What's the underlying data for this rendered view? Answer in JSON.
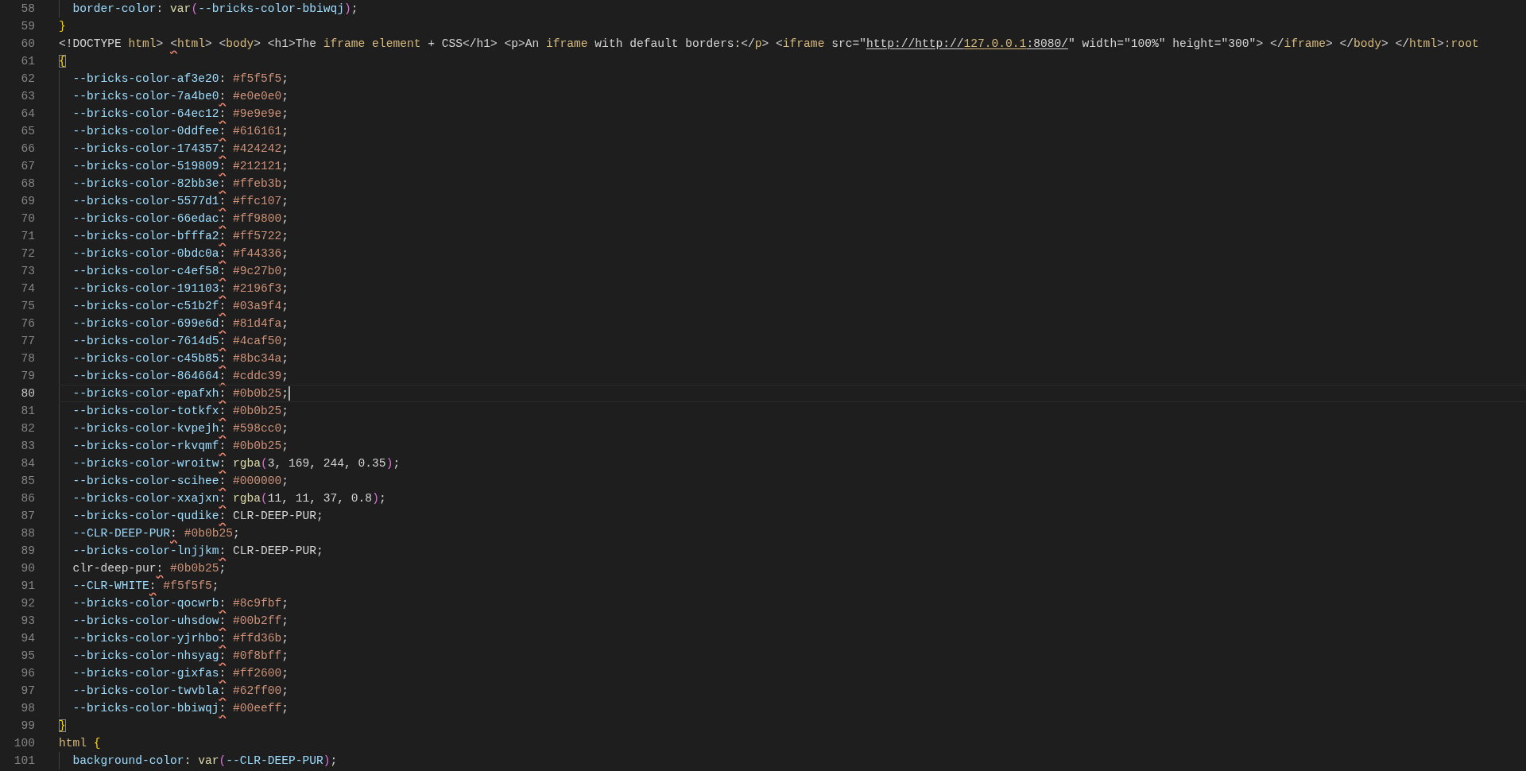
{
  "editor": {
    "lines": [
      {
        "number": "58",
        "current": false,
        "indented": true,
        "tokens": [
          {
            "kind": "prop",
            "text": "border-color"
          },
          {
            "kind": "plain",
            "text": ": "
          },
          {
            "kind": "func",
            "text": "var"
          },
          {
            "kind": "paren",
            "text": "("
          },
          {
            "kind": "prop",
            "text": "--bricks-color-bbiwqj"
          },
          {
            "kind": "paren",
            "text": ")"
          },
          {
            "kind": "plain",
            "text": ";"
          }
        ]
      },
      {
        "number": "59",
        "current": false,
        "indented": false,
        "tokens": [
          {
            "kind": "brace",
            "text": "}"
          }
        ]
      },
      {
        "number": "60",
        "current": false,
        "indented": false,
        "tokens": [
          {
            "kind": "plain",
            "text": "<!DOCTYPE "
          },
          {
            "kind": "tag",
            "text": "html"
          },
          {
            "kind": "plain",
            "text": "> "
          },
          {
            "kind": "error_punct",
            "text": "<"
          },
          {
            "kind": "tag",
            "text": "html"
          },
          {
            "kind": "plain",
            "text": "> <"
          },
          {
            "kind": "tag",
            "text": "body"
          },
          {
            "kind": "plain",
            "text": "> <h1>The "
          },
          {
            "kind": "tag",
            "text": "iframe element"
          },
          {
            "kind": "plain",
            "text": " + CSS</h1> <p>An "
          },
          {
            "kind": "tag",
            "text": "iframe"
          },
          {
            "kind": "plain",
            "text": " with default borders:</"
          },
          {
            "kind": "tag",
            "text": "p"
          },
          {
            "kind": "plain",
            "text": "> <"
          },
          {
            "kind": "tag",
            "text": "iframe"
          },
          {
            "kind": "plain",
            "text": " src=\""
          },
          {
            "kind": "link",
            "text": "http://http://"
          },
          {
            "kind": "link_number",
            "text": "127.0.0.1"
          },
          {
            "kind": "link",
            "text": ":8080/"
          },
          {
            "kind": "plain",
            "text": "\" width=\"100%\" height=\"300\"> </"
          },
          {
            "kind": "tag",
            "text": "iframe"
          },
          {
            "kind": "plain",
            "text": "> </"
          },
          {
            "kind": "tag",
            "text": "body"
          },
          {
            "kind": "plain",
            "text": "> </"
          },
          {
            "kind": "tag",
            "text": "html"
          },
          {
            "kind": "plain",
            "text": ">"
          },
          {
            "kind": "tag",
            "text": ":root"
          }
        ]
      },
      {
        "number": "61",
        "current": false,
        "indented": false,
        "tokens": [
          {
            "kind": "brace_match",
            "text": "{"
          }
        ]
      },
      {
        "number": "62",
        "current": false,
        "indented": true,
        "tokens": [
          {
            "kind": "prop",
            "text": "--bricks-color-af3e20"
          },
          {
            "kind": "plain",
            "text": ":"
          },
          {
            "kind": "value",
            "text": " #f5f5f5"
          },
          {
            "kind": "plain",
            "text": ";"
          }
        ]
      },
      {
        "number": "63",
        "current": false,
        "indented": true,
        "tokens": [
          {
            "kind": "prop",
            "text": "--bricks-color-7a4be0"
          },
          {
            "kind": "error_punct",
            "text": ":"
          },
          {
            "kind": "value",
            "text": " #e0e0e0"
          },
          {
            "kind": "plain",
            "text": ";"
          }
        ]
      },
      {
        "number": "64",
        "current": false,
        "indented": true,
        "tokens": [
          {
            "kind": "prop",
            "text": "--bricks-color-64ec12"
          },
          {
            "kind": "error_punct",
            "text": ":"
          },
          {
            "kind": "value",
            "text": " #9e9e9e"
          },
          {
            "kind": "plain",
            "text": ";"
          }
        ]
      },
      {
        "number": "65",
        "current": false,
        "indented": true,
        "tokens": [
          {
            "kind": "prop",
            "text": "--bricks-color-0ddfee"
          },
          {
            "kind": "error_punct",
            "text": ":"
          },
          {
            "kind": "value",
            "text": " #616161"
          },
          {
            "kind": "plain",
            "text": ";"
          }
        ]
      },
      {
        "number": "66",
        "current": false,
        "indented": true,
        "tokens": [
          {
            "kind": "prop",
            "text": "--bricks-color-174357"
          },
          {
            "kind": "error_punct",
            "text": ":"
          },
          {
            "kind": "value",
            "text": " #424242"
          },
          {
            "kind": "plain",
            "text": ";"
          }
        ]
      },
      {
        "number": "67",
        "current": false,
        "indented": true,
        "tokens": [
          {
            "kind": "prop",
            "text": "--bricks-color-519809"
          },
          {
            "kind": "error_punct",
            "text": ":"
          },
          {
            "kind": "value",
            "text": " #212121"
          },
          {
            "kind": "plain",
            "text": ";"
          }
        ]
      },
      {
        "number": "68",
        "current": false,
        "indented": true,
        "tokens": [
          {
            "kind": "prop",
            "text": "--bricks-color-82bb3e"
          },
          {
            "kind": "error_punct",
            "text": ":"
          },
          {
            "kind": "value",
            "text": " #ffeb3b"
          },
          {
            "kind": "plain",
            "text": ";"
          }
        ]
      },
      {
        "number": "69",
        "current": false,
        "indented": true,
        "tokens": [
          {
            "kind": "prop",
            "text": "--bricks-color-5577d1"
          },
          {
            "kind": "error_punct",
            "text": ":"
          },
          {
            "kind": "value",
            "text": " #ffc107"
          },
          {
            "kind": "plain",
            "text": ";"
          }
        ]
      },
      {
        "number": "70",
        "current": false,
        "indented": true,
        "tokens": [
          {
            "kind": "prop",
            "text": "--bricks-color-66edac"
          },
          {
            "kind": "error_punct",
            "text": ":"
          },
          {
            "kind": "value",
            "text": " #ff9800"
          },
          {
            "kind": "plain",
            "text": ";"
          }
        ]
      },
      {
        "number": "71",
        "current": false,
        "indented": true,
        "tokens": [
          {
            "kind": "prop",
            "text": "--bricks-color-bfffa2"
          },
          {
            "kind": "error_punct",
            "text": ":"
          },
          {
            "kind": "value",
            "text": " #ff5722"
          },
          {
            "kind": "plain",
            "text": ";"
          }
        ]
      },
      {
        "number": "72",
        "current": false,
        "indented": true,
        "tokens": [
          {
            "kind": "prop",
            "text": "--bricks-color-0bdc0a"
          },
          {
            "kind": "error_punct",
            "text": ":"
          },
          {
            "kind": "value",
            "text": " #f44336"
          },
          {
            "kind": "plain",
            "text": ";"
          }
        ]
      },
      {
        "number": "73",
        "current": false,
        "indented": true,
        "tokens": [
          {
            "kind": "prop",
            "text": "--bricks-color-c4ef58"
          },
          {
            "kind": "error_punct",
            "text": ":"
          },
          {
            "kind": "value",
            "text": " #9c27b0"
          },
          {
            "kind": "plain",
            "text": ";"
          }
        ]
      },
      {
        "number": "74",
        "current": false,
        "indented": true,
        "tokens": [
          {
            "kind": "prop",
            "text": "--bricks-color-191103"
          },
          {
            "kind": "error_punct",
            "text": ":"
          },
          {
            "kind": "value",
            "text": " #2196f3"
          },
          {
            "kind": "plain",
            "text": ";"
          }
        ]
      },
      {
        "number": "75",
        "current": false,
        "indented": true,
        "tokens": [
          {
            "kind": "prop",
            "text": "--bricks-color-c51b2f"
          },
          {
            "kind": "error_punct",
            "text": ":"
          },
          {
            "kind": "value",
            "text": " #03a9f4"
          },
          {
            "kind": "plain",
            "text": ";"
          }
        ]
      },
      {
        "number": "76",
        "current": false,
        "indented": true,
        "tokens": [
          {
            "kind": "prop",
            "text": "--bricks-color-699e6d"
          },
          {
            "kind": "error_punct",
            "text": ":"
          },
          {
            "kind": "value",
            "text": " #81d4fa"
          },
          {
            "kind": "plain",
            "text": ";"
          }
        ]
      },
      {
        "number": "77",
        "current": false,
        "indented": true,
        "tokens": [
          {
            "kind": "prop",
            "text": "--bricks-color-7614d5"
          },
          {
            "kind": "error_punct",
            "text": ":"
          },
          {
            "kind": "value",
            "text": " #4caf50"
          },
          {
            "kind": "plain",
            "text": ";"
          }
        ]
      },
      {
        "number": "78",
        "current": false,
        "indented": true,
        "tokens": [
          {
            "kind": "prop",
            "text": "--bricks-color-c45b85"
          },
          {
            "kind": "error_punct",
            "text": ":"
          },
          {
            "kind": "value",
            "text": " #8bc34a"
          },
          {
            "kind": "plain",
            "text": ";"
          }
        ]
      },
      {
        "number": "79",
        "current": false,
        "indented": true,
        "tokens": [
          {
            "kind": "prop",
            "text": "--bricks-color-864664"
          },
          {
            "kind": "error_punct",
            "text": ":"
          },
          {
            "kind": "value",
            "text": " #cddc39"
          },
          {
            "kind": "plain",
            "text": ";"
          }
        ]
      },
      {
        "number": "80",
        "current": true,
        "indented": true,
        "tokens": [
          {
            "kind": "prop",
            "text": "--bricks-color-epafxh"
          },
          {
            "kind": "error_punct",
            "text": ":"
          },
          {
            "kind": "value",
            "text": " #0b0b25"
          },
          {
            "kind": "plain",
            "text": ";"
          }
        ]
      },
      {
        "number": "81",
        "current": false,
        "indented": true,
        "tokens": [
          {
            "kind": "prop",
            "text": "--bricks-color-totkfx"
          },
          {
            "kind": "error_punct",
            "text": ":"
          },
          {
            "kind": "value",
            "text": " #0b0b25"
          },
          {
            "kind": "plain",
            "text": ";"
          }
        ]
      },
      {
        "number": "82",
        "current": false,
        "indented": true,
        "tokens": [
          {
            "kind": "prop",
            "text": "--bricks-color-kvpejh"
          },
          {
            "kind": "error_punct",
            "text": ":"
          },
          {
            "kind": "value",
            "text": " #598cc0"
          },
          {
            "kind": "plain",
            "text": ";"
          }
        ]
      },
      {
        "number": "83",
        "current": false,
        "indented": true,
        "tokens": [
          {
            "kind": "prop",
            "text": "--bricks-color-rkvqmf"
          },
          {
            "kind": "error_punct",
            "text": ":"
          },
          {
            "kind": "value",
            "text": " #0b0b25"
          },
          {
            "kind": "plain",
            "text": ";"
          }
        ]
      },
      {
        "number": "84",
        "current": false,
        "indented": true,
        "tokens": [
          {
            "kind": "prop",
            "text": "--bricks-color-wroitw"
          },
          {
            "kind": "error_punct",
            "text": ":"
          },
          {
            "kind": "func",
            "text": " rgba"
          },
          {
            "kind": "paren",
            "text": "("
          },
          {
            "kind": "plain",
            "text": "3, 169, 244, 0.35"
          },
          {
            "kind": "paren",
            "text": ")"
          },
          {
            "kind": "plain",
            "text": ";"
          }
        ]
      },
      {
        "number": "85",
        "current": false,
        "indented": true,
        "tokens": [
          {
            "kind": "prop",
            "text": "--bricks-color-scihee"
          },
          {
            "kind": "error_punct",
            "text": ":"
          },
          {
            "kind": "value",
            "text": " #000000"
          },
          {
            "kind": "plain",
            "text": ";"
          }
        ]
      },
      {
        "number": "86",
        "current": false,
        "indented": true,
        "tokens": [
          {
            "kind": "prop",
            "text": "--bricks-color-xxajxn"
          },
          {
            "kind": "error_punct",
            "text": ":"
          },
          {
            "kind": "func",
            "text": " rgba"
          },
          {
            "kind": "paren",
            "text": "("
          },
          {
            "kind": "plain",
            "text": "11, 11, 37, 0.8"
          },
          {
            "kind": "paren",
            "text": ")"
          },
          {
            "kind": "plain",
            "text": ";"
          }
        ]
      },
      {
        "number": "87",
        "current": false,
        "indented": true,
        "tokens": [
          {
            "kind": "prop",
            "text": "--bricks-color-qudike"
          },
          {
            "kind": "error_punct",
            "text": ":"
          },
          {
            "kind": "plain",
            "text": " CLR-DEEP-PUR;"
          }
        ]
      },
      {
        "number": "88",
        "current": false,
        "indented": true,
        "tokens": [
          {
            "kind": "prop",
            "text": "--CLR-DEEP-PUR"
          },
          {
            "kind": "error_punct",
            "text": ":"
          },
          {
            "kind": "value",
            "text": " #0b0b25"
          },
          {
            "kind": "plain",
            "text": ";"
          }
        ]
      },
      {
        "number": "89",
        "current": false,
        "indented": true,
        "tokens": [
          {
            "kind": "prop",
            "text": "--bricks-color-lnjjkm"
          },
          {
            "kind": "error_punct",
            "text": ":"
          },
          {
            "kind": "plain",
            "text": " CLR-DEEP-PUR;"
          }
        ]
      },
      {
        "number": "90",
        "current": false,
        "indented": true,
        "tokens": [
          {
            "kind": "plain",
            "text": "clr-deep-pur"
          },
          {
            "kind": "error_punct",
            "text": ":"
          },
          {
            "kind": "value",
            "text": " #0b0b25"
          },
          {
            "kind": "plain",
            "text": ";"
          }
        ]
      },
      {
        "number": "91",
        "current": false,
        "indented": true,
        "tokens": [
          {
            "kind": "prop",
            "text": "--CLR-WHITE"
          },
          {
            "kind": "error_punct",
            "text": ":"
          },
          {
            "kind": "value",
            "text": " #f5f5f5"
          },
          {
            "kind": "plain",
            "text": ";"
          }
        ]
      },
      {
        "number": "92",
        "current": false,
        "indented": true,
        "tokens": [
          {
            "kind": "prop",
            "text": "--bricks-color-qocwrb"
          },
          {
            "kind": "error_punct",
            "text": ":"
          },
          {
            "kind": "value",
            "text": " #8c9fbf"
          },
          {
            "kind": "plain",
            "text": ";"
          }
        ]
      },
      {
        "number": "93",
        "current": false,
        "indented": true,
        "tokens": [
          {
            "kind": "prop",
            "text": "--bricks-color-uhsdow"
          },
          {
            "kind": "error_punct",
            "text": ":"
          },
          {
            "kind": "value",
            "text": " #00b2ff"
          },
          {
            "kind": "plain",
            "text": ";"
          }
        ]
      },
      {
        "number": "94",
        "current": false,
        "indented": true,
        "tokens": [
          {
            "kind": "prop",
            "text": "--bricks-color-yjrhbo"
          },
          {
            "kind": "error_punct",
            "text": ":"
          },
          {
            "kind": "value",
            "text": " #ffd36b"
          },
          {
            "kind": "plain",
            "text": ";"
          }
        ]
      },
      {
        "number": "95",
        "current": false,
        "indented": true,
        "tokens": [
          {
            "kind": "prop",
            "text": "--bricks-color-nhsyag"
          },
          {
            "kind": "error_punct",
            "text": ":"
          },
          {
            "kind": "value",
            "text": " #0f8bff"
          },
          {
            "kind": "plain",
            "text": ";"
          }
        ]
      },
      {
        "number": "96",
        "current": false,
        "indented": true,
        "tokens": [
          {
            "kind": "prop",
            "text": "--bricks-color-gixfas"
          },
          {
            "kind": "error_punct",
            "text": ":"
          },
          {
            "kind": "value",
            "text": " #ff2600"
          },
          {
            "kind": "plain",
            "text": ";"
          }
        ]
      },
      {
        "number": "97",
        "current": false,
        "indented": true,
        "tokens": [
          {
            "kind": "prop",
            "text": "--bricks-color-twvbla"
          },
          {
            "kind": "error_punct",
            "text": ":"
          },
          {
            "kind": "value",
            "text": " #62ff00"
          },
          {
            "kind": "plain",
            "text": ";"
          }
        ]
      },
      {
        "number": "98",
        "current": false,
        "indented": true,
        "tokens": [
          {
            "kind": "prop",
            "text": "--bricks-color-bbiwqj"
          },
          {
            "kind": "error_punct",
            "text": ":"
          },
          {
            "kind": "value",
            "text": " #00eeff"
          },
          {
            "kind": "plain",
            "text": ";"
          }
        ]
      },
      {
        "number": "99",
        "current": false,
        "indented": false,
        "tokens": [
          {
            "kind": "brace_match",
            "text": "}"
          }
        ]
      },
      {
        "number": "100",
        "current": false,
        "indented": false,
        "tokens": [
          {
            "kind": "tag",
            "text": "html"
          },
          {
            "kind": "brace",
            "text": " {"
          }
        ]
      },
      {
        "number": "101",
        "current": false,
        "indented": true,
        "tokens": [
          {
            "kind": "prop",
            "text": "background-color"
          },
          {
            "kind": "plain",
            "text": ": "
          },
          {
            "kind": "func",
            "text": "var"
          },
          {
            "kind": "paren",
            "text": "("
          },
          {
            "kind": "prop",
            "text": "--CLR-DEEP-PUR"
          },
          {
            "kind": "paren",
            "text": ")"
          },
          {
            "kind": "plain",
            "text": ";"
          }
        ]
      }
    ]
  }
}
